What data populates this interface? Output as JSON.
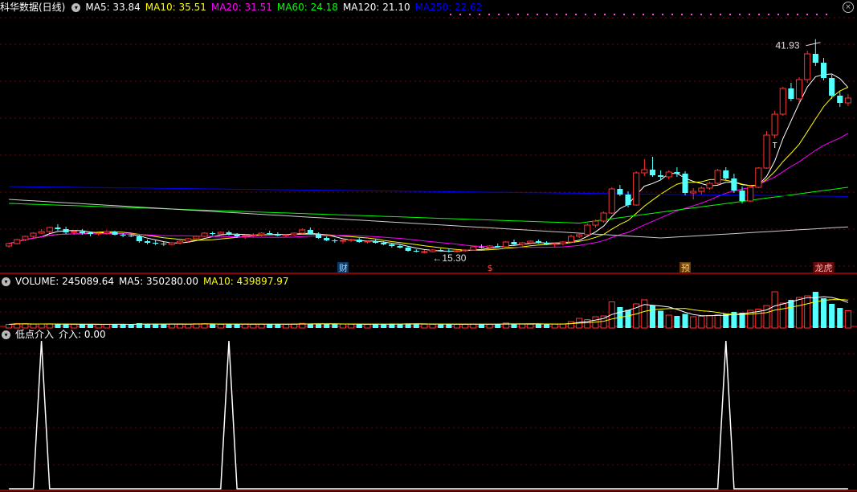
{
  "header_main": {
    "title": "科华数据(日线)",
    "ma": [
      {
        "label": "MA5: 33.84",
        "color": "#ffffff"
      },
      {
        "label": "MA10: 35.51",
        "color": "#ffff00"
      },
      {
        "label": "MA20: 31.51",
        "color": "#ff00ff"
      },
      {
        "label": "MA60: 24.18",
        "color": "#00ff00"
      },
      {
        "label": "MA120: 21.10",
        "color": "#ffffff"
      },
      {
        "label": "MA250: 22.62",
        "color": "#0000ff"
      }
    ]
  },
  "header_volume": {
    "label": "VOLUME: 245089.64",
    "ma5": "MA5: 350280.00",
    "ma10": "MA10: 439897.97"
  },
  "header_indicator": {
    "label": "低点介入",
    "value": "介入: 0.00"
  },
  "annotations": {
    "high": "41.93",
    "low": "15.30",
    "marker_cai": "财",
    "marker_s": "$",
    "marker_yu": "预",
    "marker_dragon": "龙虎",
    "t_mark": "T"
  },
  "colors": {
    "up": "#ff3333",
    "down": "#54ffff",
    "background": "#000000",
    "grid": "#7a0000",
    "panel_border": "#c00000"
  },
  "chart_data": [
    {
      "type": "candlestick",
      "panel": "price",
      "title": "科华数据(日线)",
      "ylim": [
        13,
        45
      ],
      "candles": [
        [
          16.2,
          16.6,
          16.0,
          16.5
        ],
        [
          16.5,
          17.1,
          16.4,
          17.0
        ],
        [
          17.0,
          17.5,
          16.8,
          17.4
        ],
        [
          17.4,
          17.9,
          17.2,
          17.8
        ],
        [
          17.8,
          18.3,
          17.7,
          18.0
        ],
        [
          18.0,
          18.6,
          17.8,
          18.5
        ],
        [
          18.5,
          18.9,
          18.1,
          18.3
        ],
        [
          18.3,
          18.6,
          17.7,
          17.9
        ],
        [
          17.9,
          18.2,
          17.6,
          18.0
        ],
        [
          18.0,
          18.3,
          17.6,
          17.8
        ],
        [
          17.8,
          18.0,
          17.4,
          17.7
        ],
        [
          17.7,
          17.9,
          17.5,
          17.8
        ],
        [
          17.8,
          18.2,
          17.6,
          18.0
        ],
        [
          18.0,
          18.1,
          17.5,
          17.6
        ],
        [
          17.6,
          17.8,
          17.3,
          17.5
        ],
        [
          17.5,
          17.7,
          17.3,
          17.4
        ],
        [
          17.4,
          17.6,
          16.6,
          16.8
        ],
        [
          16.8,
          17.0,
          16.4,
          16.6
        ],
        [
          16.6,
          16.9,
          16.3,
          16.5
        ],
        [
          16.5,
          16.7,
          16.2,
          16.4
        ],
        [
          16.4,
          16.7,
          16.3,
          16.6
        ],
        [
          16.6,
          16.9,
          16.4,
          16.8
        ],
        [
          16.8,
          17.2,
          16.6,
          17.1
        ],
        [
          17.1,
          17.5,
          17.0,
          17.4
        ],
        [
          17.4,
          17.9,
          17.3,
          17.8
        ],
        [
          17.8,
          18.0,
          17.5,
          17.7
        ],
        [
          17.7,
          18.0,
          17.6,
          17.9
        ],
        [
          17.9,
          18.1,
          17.5,
          17.6
        ],
        [
          17.6,
          17.8,
          17.2,
          17.4
        ],
        [
          17.4,
          17.6,
          17.1,
          17.5
        ],
        [
          17.5,
          17.8,
          17.3,
          17.6
        ],
        [
          17.6,
          17.9,
          17.4,
          17.8
        ],
        [
          17.8,
          18.1,
          17.6,
          17.7
        ],
        [
          17.7,
          17.9,
          17.4,
          17.5
        ],
        [
          17.5,
          17.7,
          17.3,
          17.6
        ],
        [
          17.6,
          17.9,
          17.5,
          17.8
        ],
        [
          17.8,
          18.4,
          17.7,
          18.2
        ],
        [
          18.2,
          18.5,
          17.6,
          17.7
        ],
        [
          17.7,
          17.9,
          17.1,
          17.2
        ],
        [
          17.2,
          17.4,
          16.8,
          16.9
        ],
        [
          16.9,
          17.1,
          16.6,
          16.8
        ],
        [
          16.8,
          17.0,
          16.5,
          16.9
        ],
        [
          16.9,
          17.1,
          16.7,
          17.0
        ],
        [
          17.0,
          17.2,
          16.6,
          16.7
        ],
        [
          16.7,
          16.9,
          16.5,
          16.8
        ],
        [
          16.8,
          17.0,
          16.5,
          16.6
        ],
        [
          16.6,
          16.8,
          16.3,
          16.4
        ],
        [
          16.4,
          16.6,
          16.0,
          16.2
        ],
        [
          16.2,
          16.4,
          15.9,
          16.0
        ],
        [
          16.0,
          16.2,
          15.5,
          15.6
        ],
        [
          15.6,
          15.8,
          15.4,
          15.5
        ],
        [
          15.5,
          15.7,
          15.3,
          15.5
        ],
        [
          15.5,
          15.8,
          15.4,
          15.7
        ],
        [
          15.7,
          15.9,
          15.5,
          15.6
        ],
        [
          15.6,
          15.8,
          15.4,
          15.5
        ],
        [
          15.5,
          15.7,
          15.4,
          15.6
        ],
        [
          15.6,
          15.8,
          15.5,
          15.7
        ],
        [
          15.7,
          16.2,
          15.6,
          16.1
        ],
        [
          16.1,
          16.4,
          15.9,
          16.0
        ],
        [
          16.0,
          16.3,
          15.8,
          16.2
        ],
        [
          16.2,
          16.5,
          16.0,
          16.1
        ],
        [
          16.1,
          16.8,
          16.0,
          16.7
        ],
        [
          16.7,
          17.0,
          16.2,
          16.4
        ],
        [
          16.4,
          16.7,
          16.2,
          16.6
        ],
        [
          16.6,
          16.9,
          16.4,
          16.8
        ],
        [
          16.8,
          17.0,
          16.5,
          16.6
        ],
        [
          16.6,
          16.8,
          16.3,
          16.4
        ],
        [
          16.4,
          16.6,
          16.1,
          16.5
        ],
        [
          16.5,
          16.8,
          16.3,
          16.7
        ],
        [
          16.7,
          17.6,
          16.6,
          17.4
        ],
        [
          17.4,
          17.8,
          17.2,
          17.6
        ],
        [
          17.6,
          19.0,
          17.5,
          18.8
        ],
        [
          18.8,
          19.5,
          18.5,
          19.3
        ],
        [
          19.3,
          20.5,
          19.1,
          20.3
        ],
        [
          20.3,
          23.5,
          20.2,
          23.3
        ],
        [
          23.3,
          23.8,
          22.4,
          22.6
        ],
        [
          22.6,
          23.0,
          21.0,
          21.3
        ],
        [
          21.3,
          25.5,
          21.2,
          25.3
        ],
        [
          25.3,
          27.0,
          24.9,
          25.7
        ],
        [
          25.7,
          27.3,
          24.8,
          25.0
        ],
        [
          25.0,
          25.6,
          24.4,
          24.8
        ],
        [
          24.8,
          25.6,
          24.5,
          25.4
        ],
        [
          25.4,
          26.0,
          24.8,
          25.2
        ],
        [
          25.2,
          25.5,
          22.5,
          22.8
        ],
        [
          22.8,
          23.4,
          22.0,
          23.0
        ],
        [
          23.0,
          23.6,
          22.6,
          23.4
        ],
        [
          23.4,
          24.2,
          23.2,
          24.0
        ],
        [
          24.0,
          25.8,
          23.8,
          25.6
        ],
        [
          25.6,
          26.0,
          24.4,
          24.6
        ],
        [
          24.6,
          25.2,
          22.8,
          23.1
        ],
        [
          23.1,
          23.6,
          21.5,
          21.8
        ],
        [
          21.8,
          23.8,
          21.7,
          23.5
        ],
        [
          23.5,
          26.0,
          23.4,
          25.9
        ],
        [
          25.9,
          30.5,
          25.8,
          30.0
        ],
        [
          30.0,
          33.0,
          29.6,
          32.6
        ],
        [
          32.6,
          36.0,
          32.4,
          35.8
        ],
        [
          35.8,
          36.5,
          34.2,
          34.5
        ],
        [
          34.5,
          37.2,
          34.0,
          36.9
        ],
        [
          36.9,
          40.5,
          36.5,
          40.1
        ],
        [
          40.1,
          41.93,
          38.6,
          39.0
        ],
        [
          39.0,
          39.6,
          36.8,
          37.1
        ],
        [
          37.1,
          37.5,
          34.5,
          34.9
        ],
        [
          34.9,
          35.5,
          33.5,
          34.0
        ],
        [
          34.0,
          35.1,
          33.6,
          34.6
        ]
      ],
      "markers": [
        "财",
        "$",
        "预",
        "龙虎"
      ]
    },
    {
      "type": "bar",
      "panel": "volume",
      "title": "VOLUME",
      "ylim": [
        0,
        1000000
      ],
      "values": [
        90000,
        110000,
        105000,
        95000,
        100000,
        98000,
        92000,
        96000,
        88000,
        90000,
        93000,
        87000,
        91000,
        95000,
        90000,
        86000,
        120000,
        98000,
        92000,
        94000,
        99000,
        102000,
        97000,
        104000,
        108000,
        95000,
        91000,
        89000,
        96000,
        100000,
        94000,
        98000,
        92000,
        97000,
        93000,
        99000,
        115000,
        103000,
        110000,
        96000,
        92000,
        97000,
        94000,
        91000,
        89000,
        95000,
        101000,
        106000,
        98000,
        112000,
        100000,
        94000,
        91000,
        89000,
        93000,
        96000,
        92000,
        98000,
        95000,
        91000,
        97000,
        125000,
        102000,
        99000,
        94000,
        97000,
        101000,
        96000,
        99000,
        160000,
        240000,
        210000,
        280000,
        300000,
        650000,
        520000,
        450000,
        600000,
        700000,
        560000,
        430000,
        320000,
        300000,
        350000,
        280000,
        290000,
        310000,
        330000,
        360000,
        400000,
        380000,
        440000,
        470000,
        560000,
        900000,
        620000,
        700000,
        760000,
        800000,
        900000,
        740000,
        600000,
        500000,
        430000
      ]
    },
    {
      "type": "line",
      "panel": "indicator",
      "title": "低点介入",
      "ylim": [
        0,
        1
      ],
      "spikes_at": [
        4,
        27,
        88
      ],
      "values": "0 everywhere except 1 at spike indices"
    }
  ]
}
